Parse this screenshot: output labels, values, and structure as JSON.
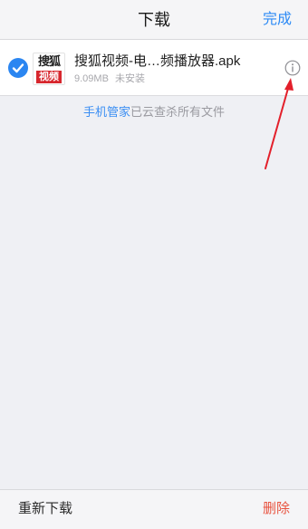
{
  "header": {
    "title": "下载",
    "done_label": "完成"
  },
  "file": {
    "selected": true,
    "icon": {
      "top_text": "搜狐",
      "bottom_text": "视频",
      "accent": "#d7262d"
    },
    "name": "搜狐视频-电…频播放器.apk",
    "size": "9.09MB",
    "status": "未安装"
  },
  "scan_note": {
    "link_text": "手机管家",
    "text": "已云查杀所有文件"
  },
  "bottom": {
    "redownload_label": "重新下载",
    "delete_label": "删除"
  },
  "colors": {
    "accent": "#2c8af5",
    "delete": "#e8533f",
    "annotation": "#e3202b"
  }
}
